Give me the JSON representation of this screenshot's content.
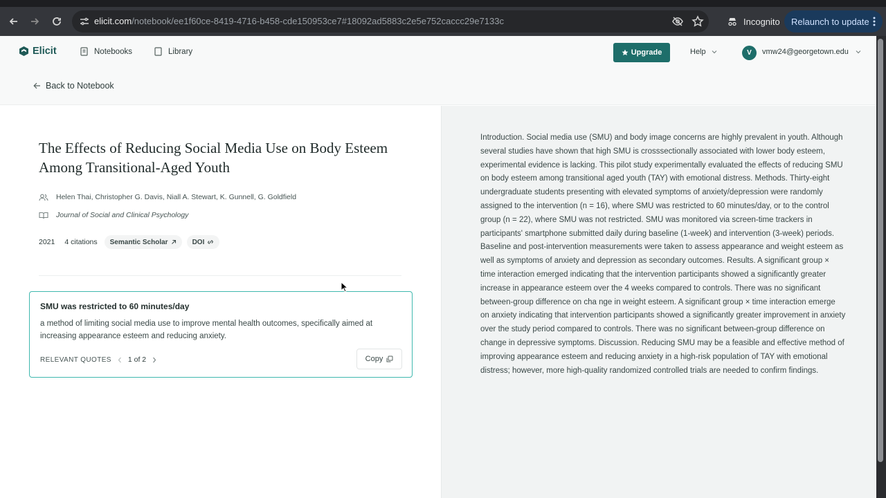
{
  "browser": {
    "url_host": "elicit.com",
    "url_path": "/notebook/ee1f60ce-8419-4716-b458-cde150953ce7#18092ad5883c2e5e752caccc29e7133c",
    "incognito_label": "Incognito",
    "relaunch_label": "Relaunch to update"
  },
  "header": {
    "brand": "Elicit",
    "nav": [
      {
        "label": "Notebooks",
        "icon": "notebook-icon"
      },
      {
        "label": "Library",
        "icon": "library-icon"
      }
    ],
    "upgrade_label": "Upgrade",
    "help_label": "Help",
    "avatar_initial": "V",
    "user_email": "vmw24@georgetown.edu"
  },
  "back_label": "Back to Notebook",
  "paper": {
    "title": "The Effects of Reducing Social Media Use on Body Esteem Among Transitional-Aged Youth",
    "authors": "Helen Thai, Christopher G. Davis, Niall A. Stewart, K. Gunnell, G. Goldfield",
    "journal": "Journal of Social and Clinical Psychology",
    "year": "2021",
    "citations": "4 citations",
    "source_chip": "Semantic Scholar",
    "doi_chip": "DOI"
  },
  "quote_card": {
    "heading": "SMU was restricted to 60 minutes/day",
    "body": "a method of limiting social media use to improve mental health outcomes, specifically aimed at increasing appearance esteem and reducing anxiety.",
    "footer_label": "RELEVANT QUOTES",
    "pager": "1 of 2",
    "copy_label": "Copy"
  },
  "abstract": "Introduction. Social media use (SMU) and body image concerns are highly prevalent in youth. Although several studies have shown that high SMU is crosssectionally associated with lower body esteem, experimental evidence is lacking. This pilot study experimentally evaluated the effects of reducing SMU on body esteem among transitional aged youth (TAY) with emotional distress. Methods. Thirty-eight undergraduate students presenting with elevated symptoms of anxiety/depression were randomly assigned to the intervention (n = 16), where SMU was restricted to 60 minutes/day, or to the control group (n = 22), where SMU was not restricted. SMU was monitored via screen-time trackers in participants' smartphone submitted daily during baseline (1-week) and intervention (3-week) periods. Baseline and post-intervention measurements were taken to assess appearance and weight esteem as well as symptoms of anxiety and depression as secondary outcomes. Results. A significant group × time interaction emerged indicating that the intervention participants showed a significantly greater increase in appearance esteem over the 4 weeks compared to controls. There was no significant between-group difference on cha nge in weight esteem. A significant group × time interaction emerge on anxiety indicating that intervention participants showed a significantly greater improvement in anxiety over the study period compared to controls. There was no significant between-group difference on change in depressive symptoms. Discussion. Reducing SMU may be a feasible and effective method of improving appearance esteem and reducing anxiety in a high-risk population of TAY with emotional distress; however, more high-quality randomized controlled trials are needed to confirm findings.",
  "colors": {
    "accent": "#1e6e6a",
    "card_border": "#3fb8ae",
    "panel_bg": "#f1f3f3"
  }
}
